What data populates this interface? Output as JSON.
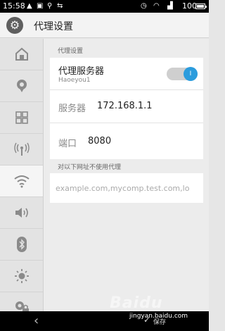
{
  "status_bar": {
    "time": "15:58",
    "battery": "100",
    "icons": [
      "warning-icon",
      "image-icon",
      "usb-icon",
      "usb-connected-icon",
      "alarm-icon",
      "wifi-icon",
      "signal-icon",
      "battery-icon"
    ]
  },
  "title_bar": {
    "title": "代理设置",
    "icon": "gear-icon"
  },
  "sidebar": {
    "items": [
      {
        "icon": "home-icon",
        "active": false
      },
      {
        "icon": "location-icon",
        "active": false
      },
      {
        "icon": "apps-grid-icon",
        "active": false
      },
      {
        "icon": "antenna-icon",
        "active": false
      },
      {
        "icon": "wifi-icon",
        "active": true
      },
      {
        "icon": "volume-icon",
        "active": false
      },
      {
        "icon": "bluetooth-icon",
        "active": false
      },
      {
        "icon": "brightness-icon",
        "active": false
      },
      {
        "icon": "lock-location-icon",
        "active": false
      }
    ]
  },
  "proxy": {
    "section_label": "代理设置",
    "server": {
      "title": "代理服务器",
      "subtitle": "Haoeyou1",
      "enabled": true,
      "toggle_glyph": "I"
    },
    "host": {
      "label": "服务器",
      "value": "172.168.1.1"
    },
    "port": {
      "label": "端口",
      "value": "8080"
    }
  },
  "bypass": {
    "section_label": "对以下网址不使用代理",
    "placeholder": "example.com,mycomp.test.com,lo"
  },
  "nav": {
    "back_glyph": "‹",
    "save_label": "保存"
  },
  "watermark": {
    "site": "jingyan.baidu.com",
    "logo": "Baidu"
  },
  "colors": {
    "accent": "#2b9cdd",
    "status_bar": "#000000",
    "nav_bar": "#000000"
  }
}
